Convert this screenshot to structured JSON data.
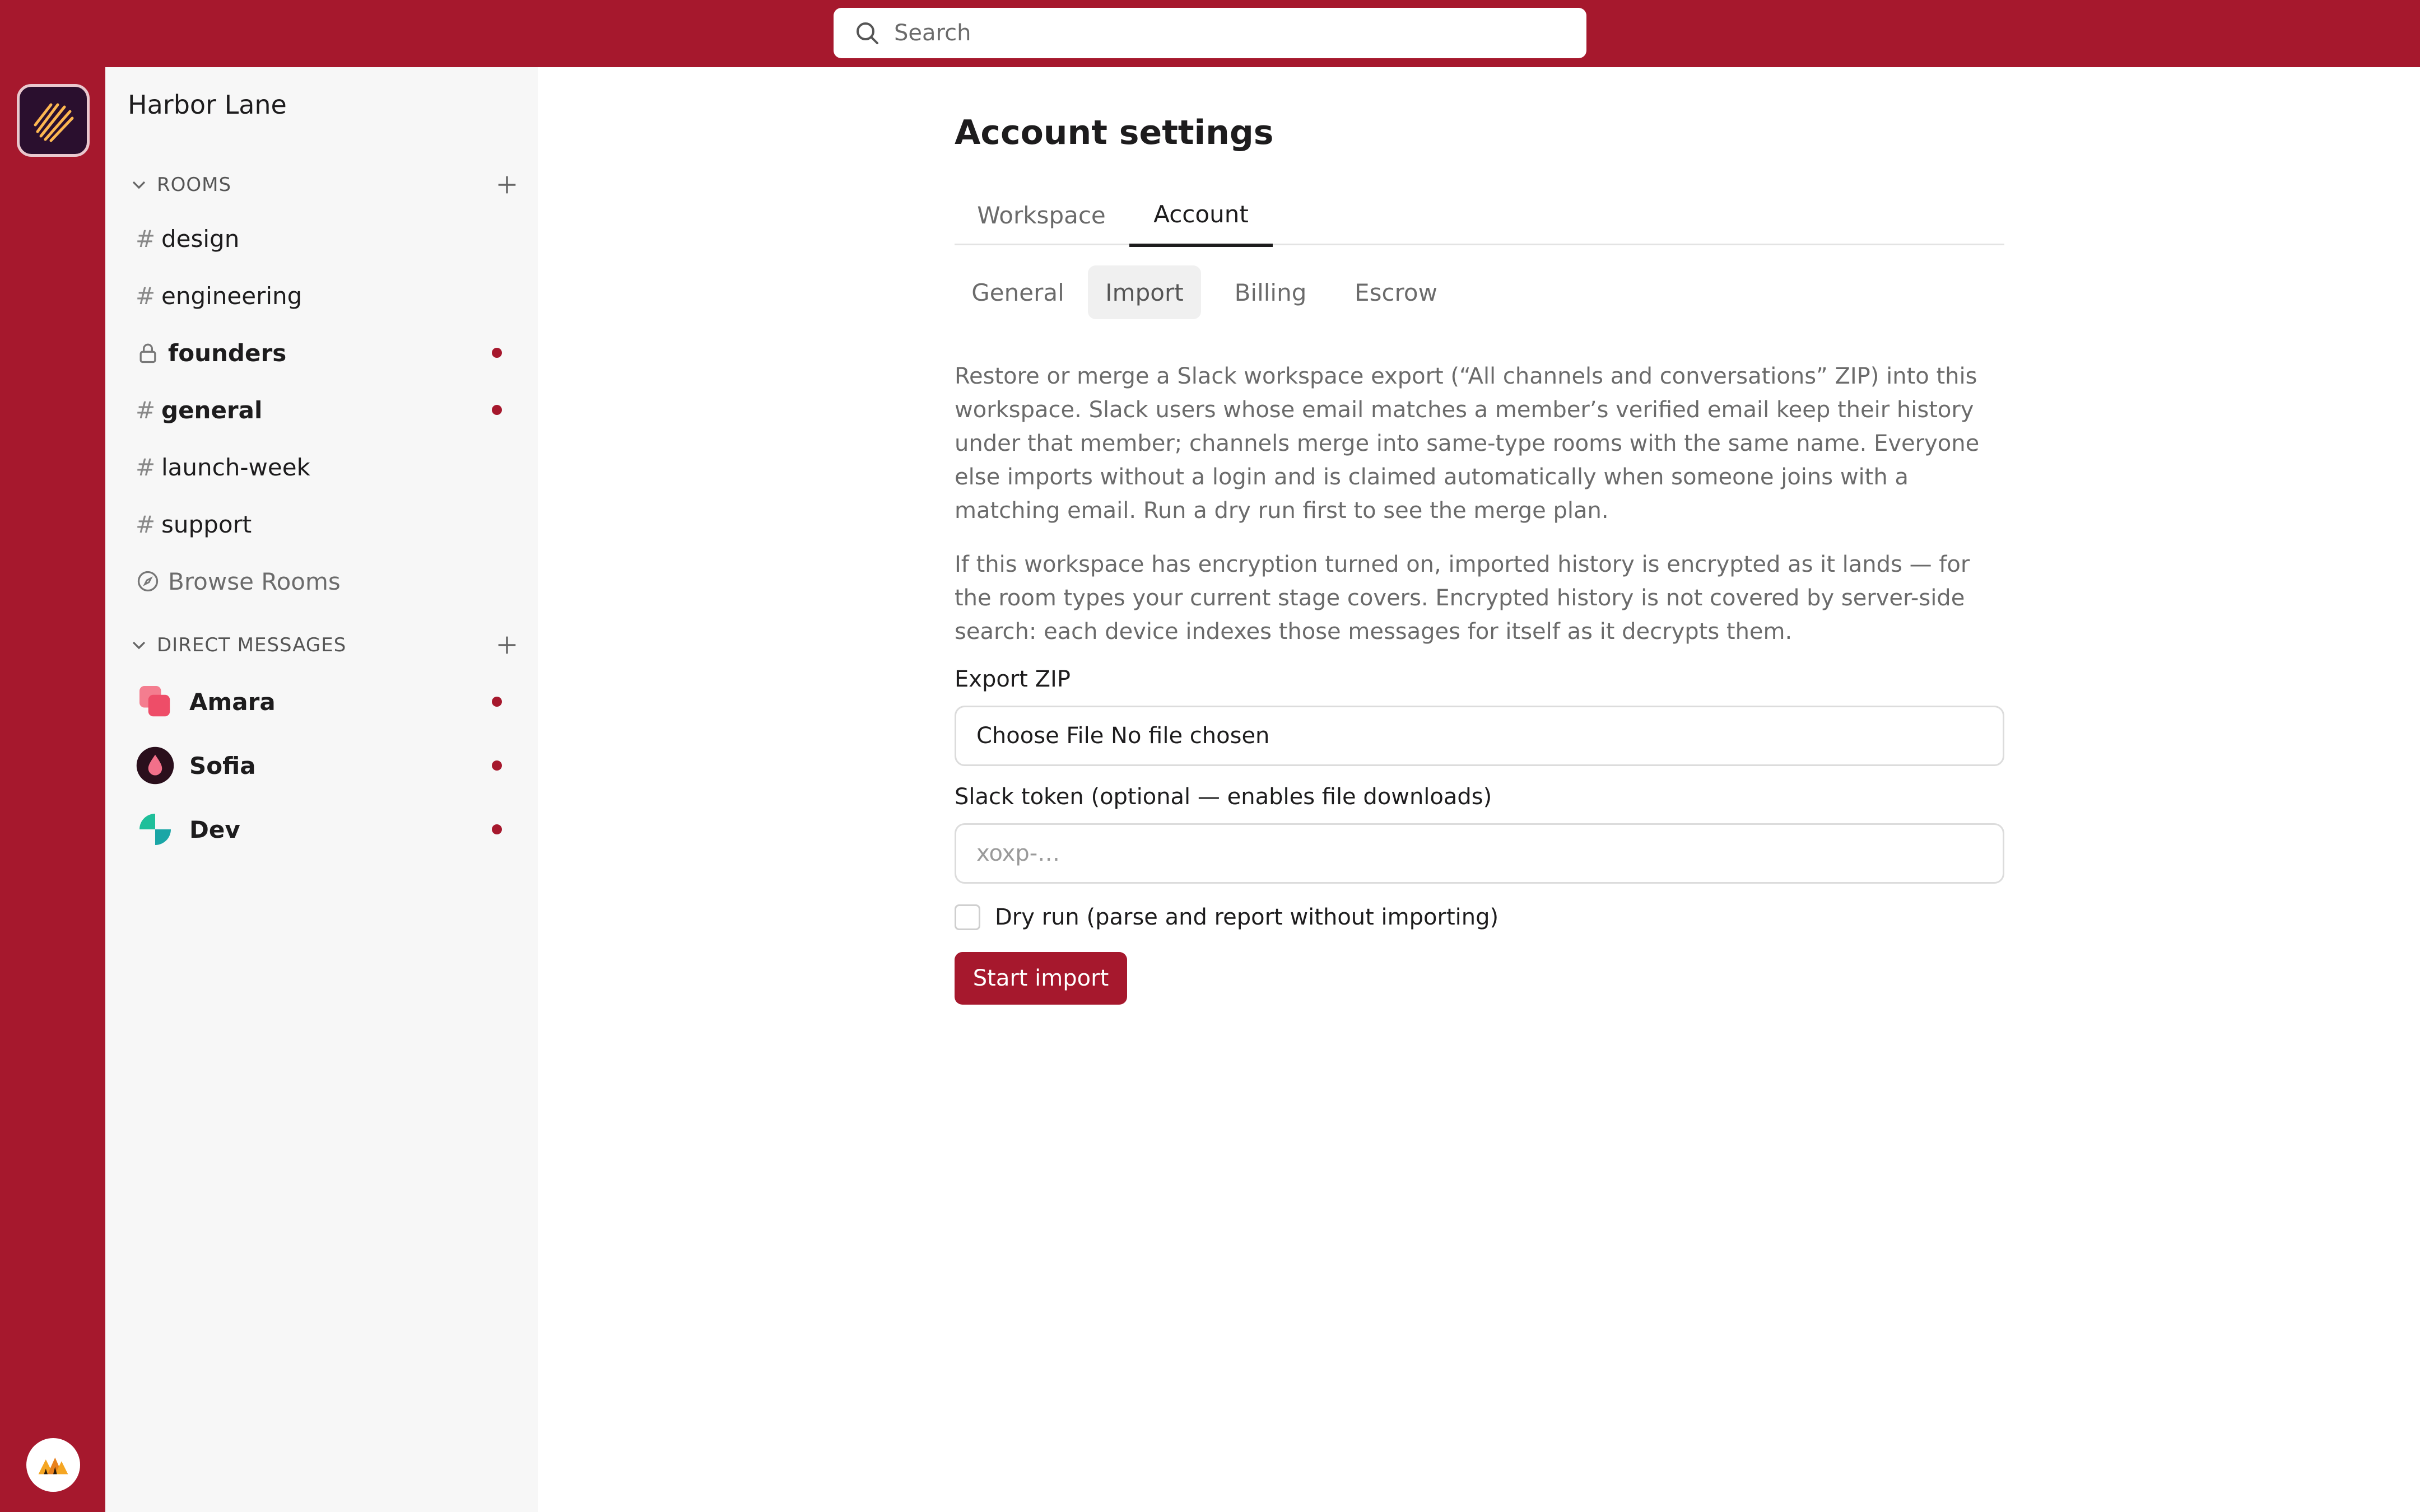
{
  "search": {
    "placeholder": "Search",
    "icon": "search-icon"
  },
  "workspace": {
    "name": "Harbor Lane"
  },
  "sidebar": {
    "rooms_header": "ROOMS",
    "rooms": [
      {
        "prefix": "#",
        "label": "design",
        "bold": false,
        "unread": false
      },
      {
        "prefix": "#",
        "label": "engineering",
        "bold": false,
        "unread": false
      },
      {
        "prefix": "lock",
        "label": "founders",
        "bold": true,
        "unread": true
      },
      {
        "prefix": "#",
        "label": "general",
        "bold": true,
        "unread": true
      },
      {
        "prefix": "#",
        "label": "launch-week",
        "bold": false,
        "unread": false
      },
      {
        "prefix": "#",
        "label": "support",
        "bold": false,
        "unread": false
      }
    ],
    "browse_rooms": "Browse Rooms",
    "dm_header": "DIRECT MESSAGES",
    "dms": [
      {
        "label": "Amara",
        "unread": true
      },
      {
        "label": "Sofia",
        "unread": true
      },
      {
        "label": "Dev",
        "unread": true
      }
    ]
  },
  "main": {
    "title": "Account settings",
    "tabs": [
      {
        "label": "Workspace",
        "active": false
      },
      {
        "label": "Account",
        "active": true
      }
    ],
    "subtabs": [
      {
        "label": "General",
        "active": false
      },
      {
        "label": "Import",
        "active": true
      },
      {
        "label": "Billing",
        "active": false
      },
      {
        "label": "Escrow",
        "active": false
      }
    ],
    "paragraph1": "Restore or merge a Slack workspace export (“All channels and conversations” ZIP) into this workspace. Slack users whose email matches a member’s verified email keep their history under that member; channels merge into same-type rooms with the same name. Everyone else imports without a login and is claimed automatically when someone joins with a matching email. Run a dry run first to see the merge plan.",
    "paragraph2": "If this workspace has encryption turned on, imported history is encrypted as it lands — for the room types your current stage covers. Encrypted history is not covered by server-side search: each device indexes those messages for itself as it decrypts them.",
    "export_label": "Export ZIP",
    "file_input_text": "Choose File No file chosen",
    "token_label": "Slack token (optional — enables file downloads)",
    "token_placeholder": "xoxp-…",
    "token_value": "",
    "dry_run_label": "Dry run (parse and report without importing)",
    "dry_run_checked": false,
    "start_button": "Start import"
  },
  "colors": {
    "brand": "#a6182d",
    "sidebar_bg": "#f7f7f7"
  }
}
